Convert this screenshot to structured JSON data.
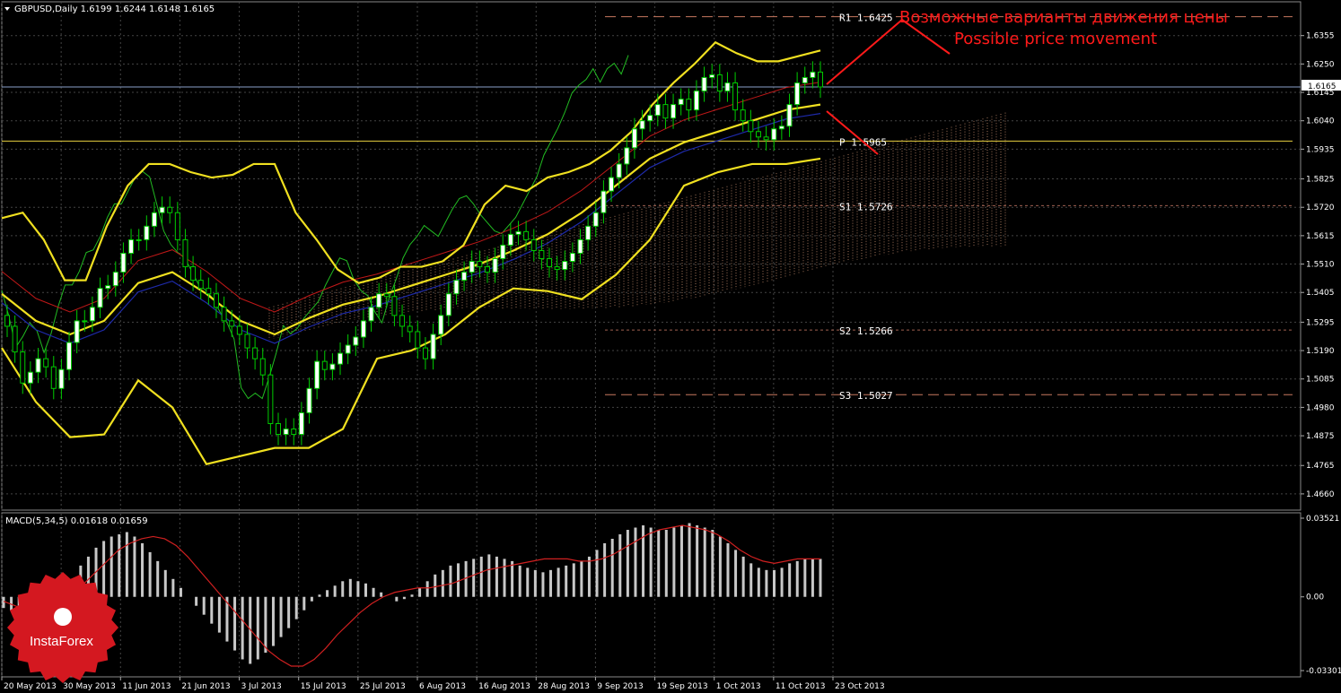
{
  "chart_data": {
    "type": "candlestick",
    "symbol_header": "GBPUSD,Daily  1.6199 1.6244 1.6148 1.6165",
    "current_price_label": "1.6165",
    "current_price": 1.6165,
    "y_range": [
      1.46,
      1.648
    ],
    "y_ticks": [
      "1.6355",
      "1.6250",
      "1.6145",
      "1.6040",
      "1.5935",
      "1.5825",
      "1.5720",
      "1.5615",
      "1.5510",
      "1.5405",
      "1.5295",
      "1.5190",
      "1.5085",
      "1.4980",
      "1.4875",
      "1.4765",
      "1.4660"
    ],
    "x_ticks": [
      "20 May 2013",
      "30 May 2013",
      "11 Jun 2013",
      "21 Jun 2013",
      "3 Jul 2013",
      "15 Jul 2013",
      "25 Jul 2013",
      "6 Aug 2013",
      "16 Aug 2013",
      "28 Aug 2013",
      "9 Sep 2013",
      "19 Sep 2013",
      "1 Oct 2013",
      "11 Oct 2013",
      "23 Oct 2013"
    ],
    "pivot_levels": [
      {
        "label": "R1 1.6425",
        "value": 1.6425,
        "color": "#c87860",
        "style": "dashed"
      },
      {
        "label": "P  1.5965",
        "value": 1.5965,
        "color": "#e8d040",
        "style": "solid"
      },
      {
        "label": "S1 1.5726",
        "value": 1.5726,
        "color": "#a06050",
        "style": "dotted"
      },
      {
        "label": "S2 1.5266",
        "value": 1.5266,
        "color": "#a06050",
        "style": "dotted"
      },
      {
        "label": "S3 1.5027",
        "value": 1.5027,
        "color": "#c87860",
        "style": "dashed"
      }
    ],
    "annotation": {
      "line1": "Возможные варианты движения цены",
      "line2": "Possible price movement",
      "color": "#ff1a1a"
    },
    "candles_close": [
      1.528,
      1.5185,
      1.507,
      1.511,
      1.516,
      1.513,
      1.505,
      1.512,
      1.522,
      1.53,
      1.53,
      1.535,
      1.542,
      1.543,
      1.548,
      1.555,
      1.56,
      1.56,
      1.565,
      1.57,
      1.572,
      1.57,
      1.56,
      1.55,
      1.545,
      1.542,
      1.54,
      1.535,
      1.53,
      1.528,
      1.525,
      1.52,
      1.516,
      1.51,
      1.492,
      1.488,
      1.49,
      1.488,
      1.496,
      1.505,
      1.515,
      1.512,
      1.514,
      1.518,
      1.521,
      1.524,
      1.53,
      1.535,
      1.54,
      1.539,
      1.532,
      1.528,
      1.526,
      1.52,
      1.516,
      1.525,
      1.532,
      1.54,
      1.545,
      1.548,
      1.552,
      1.55,
      1.548,
      1.553,
      1.558,
      1.562,
      1.563,
      1.56,
      1.556,
      1.553,
      1.55,
      1.549,
      1.552,
      1.555,
      1.56,
      1.565,
      1.57,
      1.578,
      1.583,
      1.588,
      1.594,
      1.601,
      1.604,
      1.606,
      1.61,
      1.605,
      1.61,
      1.612,
      1.608,
      1.615,
      1.62,
      1.621,
      1.615,
      1.618,
      1.608,
      1.604,
      1.6,
      1.598,
      1.597,
      1.601,
      1.602,
      1.61,
      1.618,
      1.62,
      1.622,
      1.6165
    ],
    "bollinger_upper": [
      1.568,
      1.57,
      1.56,
      1.545,
      1.545,
      1.565,
      1.58,
      1.588,
      1.588,
      1.585,
      1.583,
      1.584,
      1.588,
      1.588,
      1.57,
      1.56,
      1.549,
      1.544,
      1.546,
      1.55,
      1.55,
      1.552,
      1.558,
      1.573,
      1.58,
      1.578,
      1.583,
      1.585,
      1.588,
      1.593,
      1.6,
      1.61,
      1.618,
      1.625,
      1.633,
      1.629,
      1.626,
      1.626,
      1.628,
      1.63
    ],
    "bollinger_mid": [
      1.54,
      1.53,
      1.525,
      1.53,
      1.544,
      1.548,
      1.54,
      1.53,
      1.525,
      1.531,
      1.536,
      1.539,
      1.543,
      1.547,
      1.551,
      1.556,
      1.562,
      1.57,
      1.58,
      1.59,
      1.596,
      1.6,
      1.604,
      1.608,
      1.61
    ],
    "bollinger_lower": [
      1.52,
      1.5,
      1.487,
      1.488,
      1.508,
      1.498,
      1.477,
      1.48,
      1.483,
      1.483,
      1.49,
      1.516,
      1.519,
      1.525,
      1.535,
      1.542,
      1.541,
      1.538,
      1.547,
      1.56,
      1.58,
      1.585,
      1.588,
      1.588,
      1.59
    ],
    "macd": {
      "label": "MACD(5,34,5) 0.01618 0.01659",
      "range": [
        -0.03301,
        0.03521
      ],
      "ticks": [
        "0.03521",
        "0.00",
        "-0.03301"
      ],
      "histogram": [
        -0.005,
        -0.006,
        -0.01,
        -0.012,
        -0.01,
        -0.008,
        -0.006,
        -0.004,
        0.002,
        0.008,
        0.014,
        0.018,
        0.022,
        0.025,
        0.027,
        0.028,
        0.029,
        0.027,
        0.024,
        0.02,
        0.016,
        0.012,
        0.008,
        0.004,
        0.0,
        -0.004,
        -0.008,
        -0.012,
        -0.016,
        -0.02,
        -0.024,
        -0.028,
        -0.03,
        -0.028,
        -0.025,
        -0.022,
        -0.018,
        -0.014,
        -0.01,
        -0.006,
        -0.002,
        0.001,
        0.003,
        0.005,
        0.007,
        0.008,
        0.007,
        0.006,
        0.004,
        0.002,
        0.0,
        -0.002,
        -0.001,
        0.001,
        0.004,
        0.007,
        0.01,
        0.012,
        0.014,
        0.015,
        0.016,
        0.017,
        0.018,
        0.019,
        0.018,
        0.017,
        0.016,
        0.014,
        0.013,
        0.012,
        0.011,
        0.012,
        0.013,
        0.014,
        0.015,
        0.016,
        0.018,
        0.021,
        0.024,
        0.026,
        0.028,
        0.03,
        0.031,
        0.032,
        0.031,
        0.03,
        0.03,
        0.031,
        0.032,
        0.033,
        0.032,
        0.031,
        0.03,
        0.027,
        0.024,
        0.021,
        0.018,
        0.015,
        0.013,
        0.012,
        0.012,
        0.013,
        0.015,
        0.016,
        0.017,
        0.017,
        0.017
      ],
      "signal": [
        -0.002,
        -0.004,
        -0.006,
        -0.007,
        -0.006,
        -0.003,
        0.001,
        0.006,
        0.011,
        0.016,
        0.021,
        0.024,
        0.026,
        0.027,
        0.026,
        0.023,
        0.018,
        0.012,
        0.006,
        0.0,
        -0.006,
        -0.012,
        -0.018,
        -0.024,
        -0.028,
        -0.031,
        -0.031,
        -0.028,
        -0.023,
        -0.017,
        -0.012,
        -0.007,
        -0.003,
        0.0,
        0.002,
        0.003,
        0.004,
        0.004,
        0.005,
        0.006,
        0.008,
        0.01,
        0.012,
        0.013,
        0.014,
        0.015,
        0.016,
        0.017,
        0.017,
        0.017,
        0.016,
        0.016,
        0.017,
        0.019,
        0.022,
        0.025,
        0.028,
        0.03,
        0.031,
        0.032,
        0.031,
        0.03,
        0.028,
        0.025,
        0.021,
        0.018,
        0.016,
        0.015,
        0.016,
        0.017,
        0.017,
        0.017
      ]
    }
  },
  "logo": {
    "text": "InstaForex",
    "color": "#d41820"
  }
}
